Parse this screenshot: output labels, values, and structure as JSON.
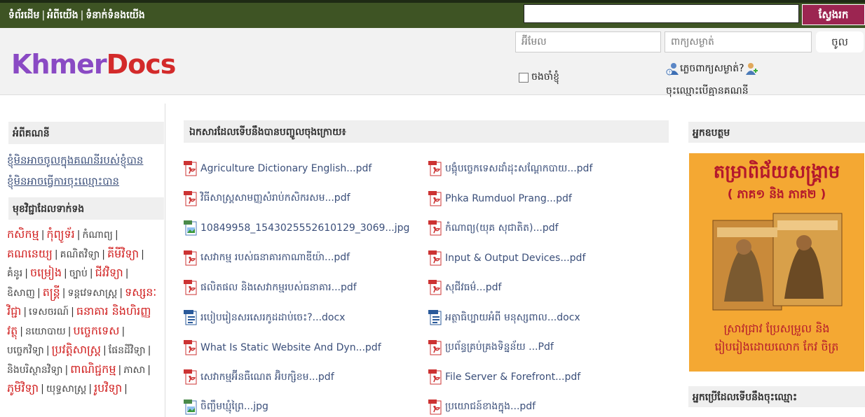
{
  "topnav": {
    "home": "ទំព័រដើម",
    "about": "អំពីយើង",
    "contact": "ទំនាក់ទំនងយើង",
    "separator": "|"
  },
  "search": {
    "value": "",
    "button": "ស្វែងរក"
  },
  "logo": {
    "part1": "Khmer",
    "part2": "Docs"
  },
  "login": {
    "email_placeholder": "អ៊ីមែល",
    "password_placeholder": "ពាក្យសម្ងាត់",
    "submit": "ចូល",
    "remember": "ចងចាំខ្ញុំ",
    "forgot": "ភ្លេចពាក្យសម្ងាត់?",
    "register": "ចុះឈ្មោះបើគ្មានគណនី"
  },
  "sidebar": {
    "account_head": "អំពីគណនី",
    "links": [
      "ខ្ញុំមិនអាចចូលក្នុងគណនីរបស់ខ្ញុំបាន",
      "ខ្ញុំមិនអាចធ្វើការចុះឈ្មោះបាន"
    ],
    "subjects_head": "មុខវិជ្ជាដែលទាក់ទង",
    "subjects": [
      {
        "label": "កសិកម្ម",
        "style": "red"
      },
      {
        "label": "កុំព្យូទ័រ",
        "style": "red"
      },
      {
        "label": "កំណាព្យ",
        "style": "nrm"
      },
      {
        "label": "គណនេយ្យ",
        "style": "red"
      },
      {
        "label": "គណិតវិទ្យា",
        "style": "nrm"
      },
      {
        "label": "គីមីវិទ្យា",
        "style": "red"
      },
      {
        "label": "គំនូរ",
        "style": "nrm"
      },
      {
        "label": "ចម្រៀង",
        "style": "red"
      },
      {
        "label": "ច្បាប់",
        "style": "nrm"
      },
      {
        "label": "ជីវវិទ្យា",
        "style": "red"
      },
      {
        "label": "ឧិសាញ",
        "style": "nrm"
      },
      {
        "label": "តន្ត្រី",
        "style": "red"
      },
      {
        "label": "ទន្តវេទសាស្ត្រ",
        "style": "nrm"
      },
      {
        "label": "ទស្សនៈវិជ្ជា",
        "style": "red"
      },
      {
        "label": "ទេសចរណ៍",
        "style": "nrm"
      },
      {
        "label": "ធនាគារ និងហិរញ្ញវត្ថុ",
        "style": "red"
      },
      {
        "label": "នយោបាយ",
        "style": "nrm"
      },
      {
        "label": "បច្ចេកទេស",
        "style": "red"
      },
      {
        "label": "បច្ចេកវិទ្យា",
        "style": "nrm"
      },
      {
        "label": "ប្រវត្តិសាស្ត្រ",
        "style": "red"
      },
      {
        "label": "ផែនដីវិទ្យា",
        "style": "nrm"
      },
      {
        "label": "និងបរិស្ថានវិទ្យា",
        "style": "nrm"
      },
      {
        "label": "ពាណិជ្ជកម្ម",
        "style": "red"
      },
      {
        "label": "ភាសា",
        "style": "nrm"
      },
      {
        "label": "ភូមិវិទ្យា",
        "style": "red"
      },
      {
        "label": "យុទ្ធសាស្ត្រ",
        "style": "nrm"
      },
      {
        "label": "រូបវិទ្យា",
        "style": "red"
      }
    ]
  },
  "main": {
    "head": "ឯកសារដែលទើបនឹងបានបញ្ចូលចុងក្រោយ៖",
    "docs": [
      {
        "name": "Agriculture Dictionary English...pdf",
        "type": "pdf"
      },
      {
        "name": "បង្កុំបច្ចេកទេសដាំដុះសណ្តែកបាយ...pdf",
        "type": "pdf"
      },
      {
        "name": "វិធីសាស្ត្រសាមញ្ញសំរាប់កសិករសម...pdf",
        "type": "pdf"
      },
      {
        "name": "Phka Rumduol Prang...pdf",
        "type": "pdf"
      },
      {
        "name": "10849958_1543025552610129_3069...jpg",
        "type": "jpg"
      },
      {
        "name": "កំណាព្យ(យុគ សុជាតិត)...pdf",
        "type": "pdf"
      },
      {
        "name": "សេវាកម្ម របស់ធនាគារកាណាឌីយ៉ា...pdf",
        "type": "pdf"
      },
      {
        "name": "Input & Output Devices...pdf",
        "type": "pdf"
      },
      {
        "name": "ផលិតផល និងសេវាកម្មរបស់ធនាគារ...pdf",
        "type": "pdf"
      },
      {
        "name": "សុជីវធម៌...pdf",
        "type": "pdf"
      },
      {
        "name": "របៀបរៀនសរសេរកូដដាប់ចេះ?...docx",
        "type": "docx"
      },
      {
        "name": "អត្ថាធិប្បាយអំពី មនុស្សពាល...docx",
        "type": "docx"
      },
      {
        "name": "What Is Static Website And Dyn...pdf",
        "type": "pdf"
      },
      {
        "name": "ប្រព័ន្ធគ្រប់គ្រងទិន្នន័យ ...Pdf",
        "type": "pdf"
      },
      {
        "name": "សេវាកម្មអ៊ីនធឺណេត អ៊ិបក្សិខម...pdf",
        "type": "pdf"
      },
      {
        "name": "File Server & Forefront...pdf",
        "type": "pdf"
      },
      {
        "name": "ចិញ្ចឹមឃ្មុំព្រៃ...jpg",
        "type": "jpg"
      },
      {
        "name": "ប្រយោជន៍ខាងក្នុង...pdf",
        "type": "pdf"
      }
    ]
  },
  "right": {
    "promo_head": "អ្នកឧបត្ថម",
    "promo_title": "តម្រាពិជ័យសង្គ្រាម",
    "promo_sub": "( ភាគ១ និង ភាគ២ )",
    "promo_line1": "ស្រាវជ្រាវ ប្រែសម្រួល និង",
    "promo_line2": "រៀបរៀងដោយលោក កែវ ចិត្រ",
    "users_head": "អ្នកប្រើដែលទើបនឹងចុះឈ្មោះ"
  },
  "colors": {
    "topbar": "#3e5424",
    "search_button": "#9c2551",
    "link": "#3b4f7a",
    "subject_red": "#d01c1c",
    "promo_bg": "#f4a833"
  }
}
